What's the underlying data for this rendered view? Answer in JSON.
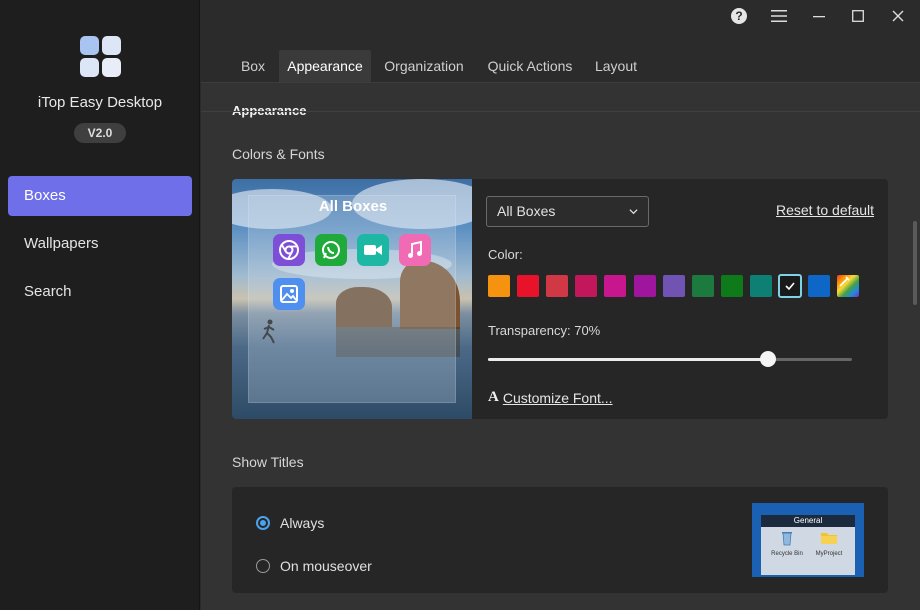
{
  "sidebar": {
    "app_name": "iTop Easy Desktop",
    "version": "V2.0",
    "items": [
      {
        "label": "Boxes",
        "active": true
      },
      {
        "label": "Wallpapers",
        "active": false
      },
      {
        "label": "Search",
        "active": false
      }
    ]
  },
  "window": {
    "help": "?"
  },
  "tabs": [
    {
      "label": "Box",
      "active": false
    },
    {
      "label": "Appearance",
      "active": true
    },
    {
      "label": "Organization",
      "active": false
    },
    {
      "label": "Quick Actions",
      "active": false
    },
    {
      "label": "Layout",
      "active": false
    }
  ],
  "appearance": {
    "section_title": "Appearance",
    "colors_fonts_label": "Colors & Fonts",
    "preview_box_title": "All Boxes",
    "box_select_value": "All Boxes",
    "reset_label": "Reset to default",
    "color_label": "Color:",
    "swatches": [
      "#f5920f",
      "#e8132b",
      "#d13845",
      "#c2185b",
      "#c8168e",
      "#a0159e",
      "#7153b4",
      "#1c7a3e",
      "#0f7a1a",
      "#0e7f73",
      "#1a1a1a",
      "#0e67c7",
      "rainbow"
    ],
    "selected_swatch": 10,
    "transparency_label": "Transparency: 70%",
    "transparency": 70,
    "customize_font_label": "Customize Font...",
    "font_icon": "A"
  },
  "show_titles": {
    "label": "Show Titles",
    "options": [
      {
        "label": "Always",
        "checked": true
      },
      {
        "label": "On mouseover",
        "checked": false
      }
    ],
    "mini_preview": {
      "title": "General",
      "items": [
        "Recycle Bin",
        "MyProject"
      ]
    }
  }
}
